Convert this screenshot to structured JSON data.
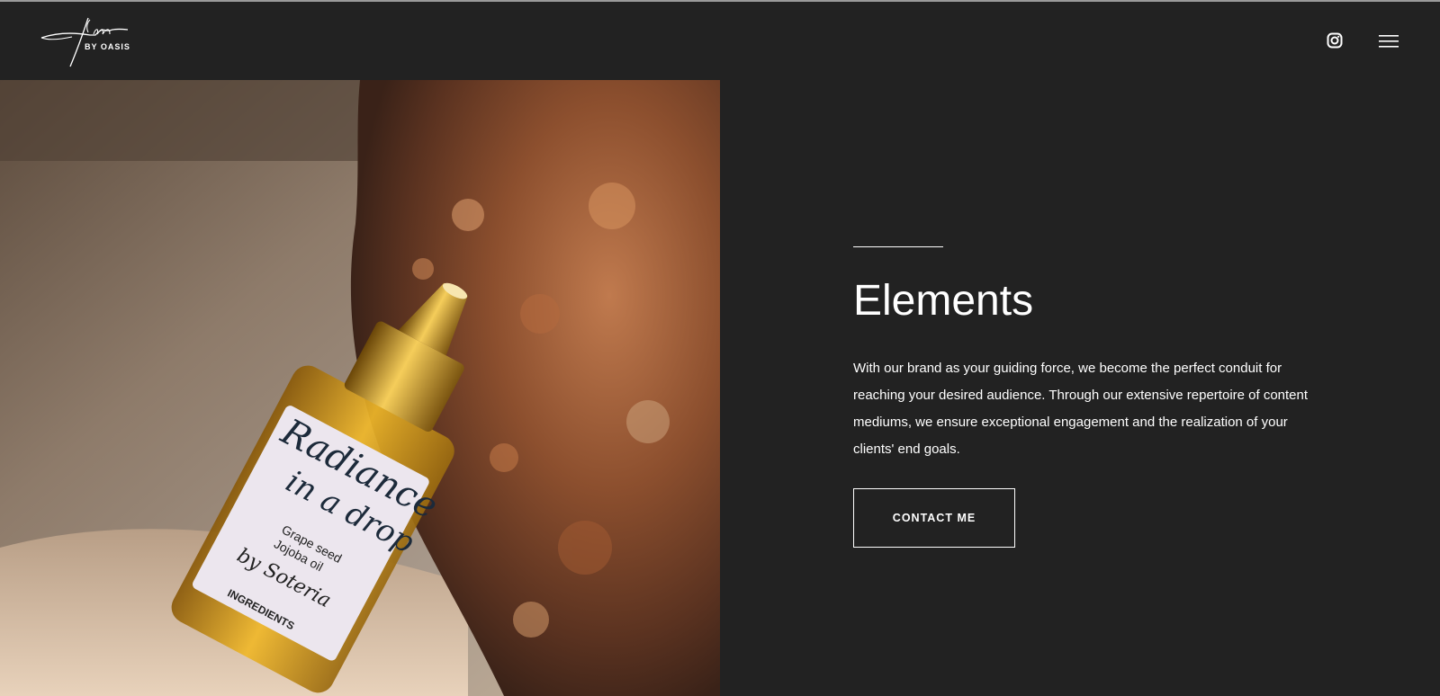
{
  "header": {
    "logo_text": "BY OASIS",
    "instagram_icon": "instagram-icon",
    "menu_icon": "hamburger-menu-icon"
  },
  "hero": {
    "image_subject": "serum bottle on rock",
    "bottle_label_line1": "Radiance",
    "bottle_label_line2": "in a drop"
  },
  "content": {
    "title": "Elements",
    "description": "With our brand as your guiding force, we become the perfect conduit for reaching your desired audience. Through our extensive repertoire of content mediums, we ensure exceptional engagement and the realization of your clients' end goals.",
    "button_label": "CONTACT ME"
  },
  "colors": {
    "background": "#222222",
    "text": "#ffffff"
  }
}
